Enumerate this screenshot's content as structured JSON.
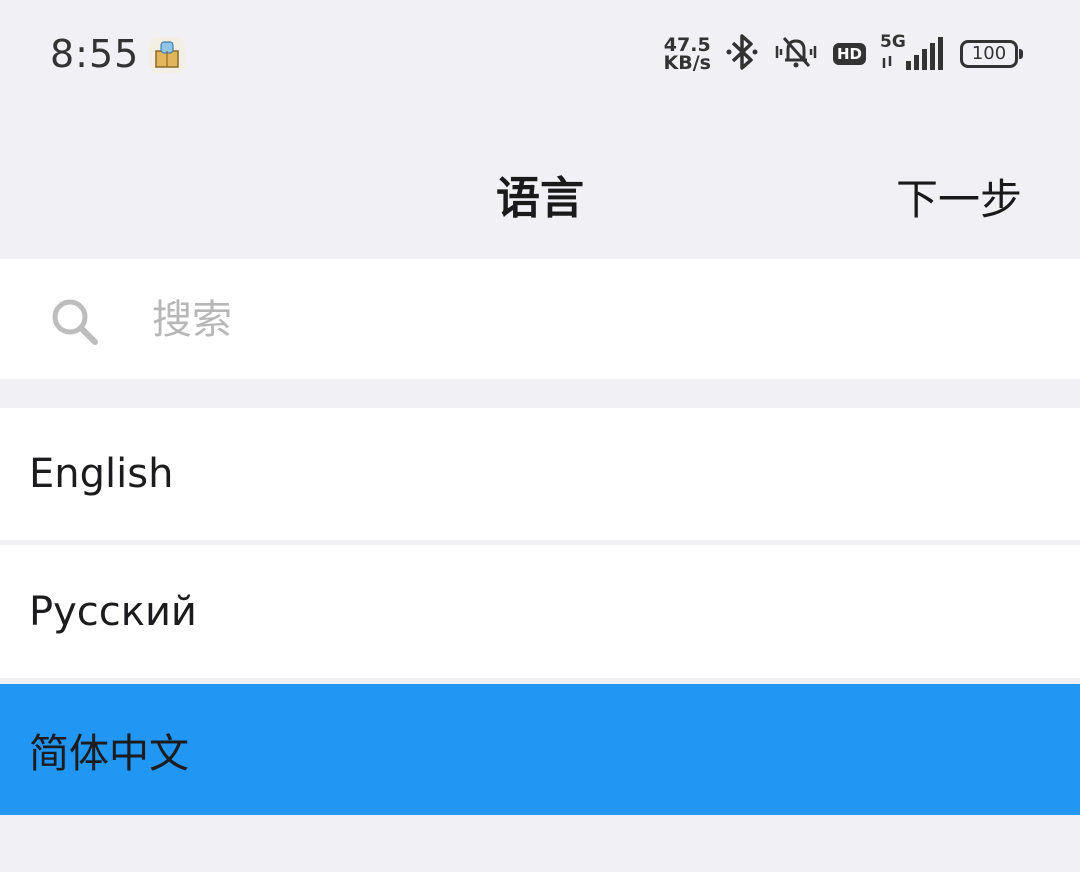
{
  "status_bar": {
    "time": "8:55",
    "net_speed_value": "47.5",
    "net_speed_unit": "KB/s",
    "hd_label": "HD",
    "network_type": "5G",
    "battery_level": "100",
    "icons": [
      "app-icon",
      "bluetooth-icon",
      "muted-bell-icon",
      "hd-icon",
      "signal-icon",
      "battery-icon"
    ]
  },
  "header": {
    "title": "语言",
    "next_label": "下一步"
  },
  "search": {
    "placeholder": "搜索",
    "value": ""
  },
  "languages": [
    {
      "label": "English",
      "selected": false
    },
    {
      "label": "Русский",
      "selected": false
    },
    {
      "label": "简体中文",
      "selected": true
    }
  ],
  "colors": {
    "background": "#f1f1f5",
    "surface": "#ffffff",
    "selected": "#2196f3",
    "placeholder": "#b7b7b7"
  }
}
